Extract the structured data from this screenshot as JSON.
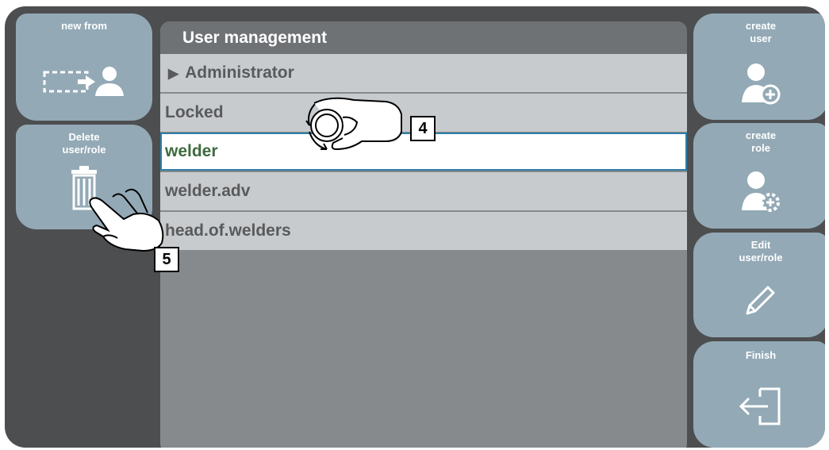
{
  "left_buttons": [
    {
      "label": "new from",
      "icon": "copy-user-icon"
    },
    {
      "label": "Delete\nuser/role",
      "icon": "trash-icon"
    }
  ],
  "right_buttons": [
    {
      "label": "create\nuser",
      "icon": "add-user-icon"
    },
    {
      "label": "create\nrole",
      "icon": "add-role-icon"
    },
    {
      "label": "Edit\nuser/role",
      "icon": "pencil-icon"
    },
    {
      "label": "Finish",
      "icon": "exit-icon"
    }
  ],
  "main": {
    "title": "User management",
    "rows": [
      {
        "label": "Administrator",
        "expandable": true
      },
      {
        "label": "Locked"
      },
      {
        "label": "welder",
        "selected": true
      },
      {
        "label": "welder.adv"
      },
      {
        "label": "head.of.welders"
      }
    ]
  },
  "callouts": [
    "4",
    "5"
  ],
  "colors": {
    "frame": "#4d4e50",
    "button": "#93a9b6",
    "list_bg": "#878a8d",
    "row_bg": "#c8cbce",
    "selected_text": "#3e6b3f",
    "selected_border": "#2f7ea8"
  }
}
